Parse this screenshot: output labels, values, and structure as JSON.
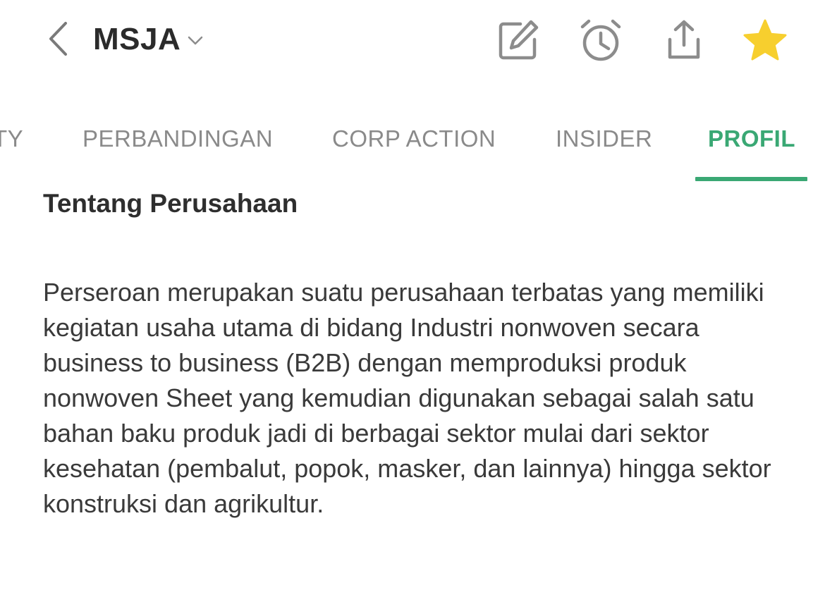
{
  "header": {
    "ticker": "MSJA",
    "icons": {
      "back": "chevron-left-icon",
      "ticker_menu": "chevron-down-icon",
      "edit": "edit-icon",
      "alarm": "alarm-icon",
      "share": "share-icon",
      "favorite": "star-icon"
    }
  },
  "tabs": [
    {
      "label": "TY",
      "active": false
    },
    {
      "label": "PERBANDINGAN",
      "active": false
    },
    {
      "label": "CORP ACTION",
      "active": false
    },
    {
      "label": "INSIDER",
      "active": false
    },
    {
      "label": "PROFIL",
      "active": true
    }
  ],
  "profile": {
    "section_title": "Tentang Perusahaan",
    "description": "Perseroan merupakan suatu perusahaan terbatas yang memiliki kegiatan usaha utama di bidang Industri nonwoven secara business to business (B2B) dengan memproduksi produk nonwoven Sheet yang kemudian digunakan sebagai salah satu bahan baku produk jadi di berbagai sektor mulai dari sektor kesehatan (pembalut, popok, masker, dan lainnya) hingga sektor konstruksi dan agrikultur."
  },
  "colors": {
    "accent_green": "#3aa874",
    "star_yellow": "#f7cf2e",
    "icon_gray": "#8c8c8c",
    "inactive_tab": "#8a8a8a",
    "text_dark": "#2e2e2e"
  }
}
